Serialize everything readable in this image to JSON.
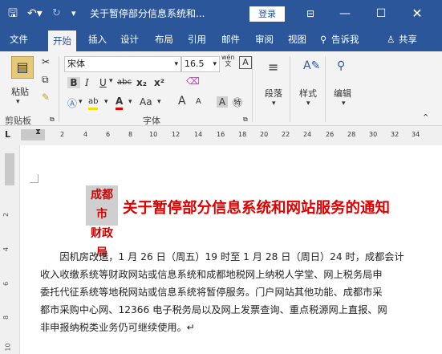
{
  "titlebar": {
    "doc_title": "关于暂停部分信息系统和...",
    "login": "登录",
    "icons": [
      "save-icon",
      "undo-icon",
      "redo-icon",
      "customize-icon",
      "ribbon-display-icon",
      "minimize-icon",
      "maximize-icon",
      "close-icon"
    ]
  },
  "tabs": [
    "文件",
    "开始",
    "插入",
    "设计",
    "布局",
    "引用",
    "邮件",
    "审阅",
    "视图"
  ],
  "tell_me": "告诉我",
  "share": "共享",
  "ribbon": {
    "paste": "粘贴",
    "font_name": "宋体",
    "font_size": "16.5",
    "clipboard_label": "剪贴板",
    "font_label": "字体",
    "paragraph": "段落",
    "styles": "样式",
    "editing": "编辑",
    "bold": "B",
    "italic": "I",
    "underline": "U",
    "strike": "abc",
    "subscript": "x₂",
    "superscript": "x²",
    "case": "Aa",
    "grow": "A",
    "shrink": "A",
    "phonetic": "wén"
  },
  "ruler": {
    "marks": [
      "2",
      "4",
      "6",
      "8",
      "10",
      "12",
      "14",
      "16",
      "18",
      "20",
      "22",
      "24",
      "26",
      "28",
      "30",
      "32",
      "34"
    ],
    "tab_selector": "L",
    "vmarks": [
      "2",
      "4",
      "6",
      "8",
      "10"
    ]
  },
  "document": {
    "seal": [
      "成都市",
      "财政局"
    ],
    "title": "关于暂停部分信息系统和网站服务的通知",
    "lines": [
      "　　因机房改造，1 月 26 日（周五）19 时至 1 月 28 日（周日）24 时，成都会计",
      "收入收缴系统等财政网站或信息系统和成都地税网上纳税人学堂、网上税务局申",
      "委托代征系统等地税网站或信息系统将暂停服务。门户网站其他功能、成都市采",
      "都市采购中心网、12366 电子税务局以及网上发票查询、重点税源网上直报、网",
      "非申报纳税类业务仍可继续使用。↵"
    ]
  },
  "colors": {
    "brand": "#2b579a",
    "title_red": "#e10000"
  }
}
